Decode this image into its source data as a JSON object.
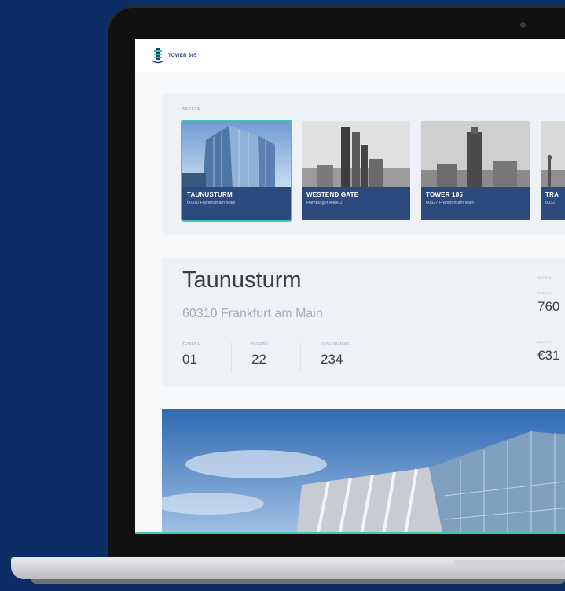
{
  "brand": {
    "name": "TOWER 365"
  },
  "assets": {
    "label": "ASSETS",
    "items": [
      {
        "name": "TAUNUSTURM",
        "address": "60310 Frankfurt am Main",
        "active": true
      },
      {
        "name": "WESTEND GATE",
        "address": "Hamburger Allee 2",
        "active": false
      },
      {
        "name": "TOWER 185",
        "address": "60327 Frankfurt am Main",
        "active": false
      },
      {
        "name": "TRA",
        "address": "6032",
        "active": false
      }
    ]
  },
  "detail": {
    "title": "Taunusturm",
    "address": "60310 Frankfurt am Main",
    "stats": [
      {
        "label": "TOWERS",
        "value": "01"
      },
      {
        "label": "FLOORS",
        "value": "22"
      },
      {
        "label": "APPOINTMENT",
        "value": "234"
      }
    ],
    "side": {
      "top_label": "OUTSTA",
      "label1": "TOTAL A",
      "value1": "760",
      "label2": "CALLS P",
      "value2": "€31"
    }
  },
  "colors": {
    "background": "#0c2d63",
    "accent": "#43c6b0",
    "caption": "#2d4a7f"
  }
}
